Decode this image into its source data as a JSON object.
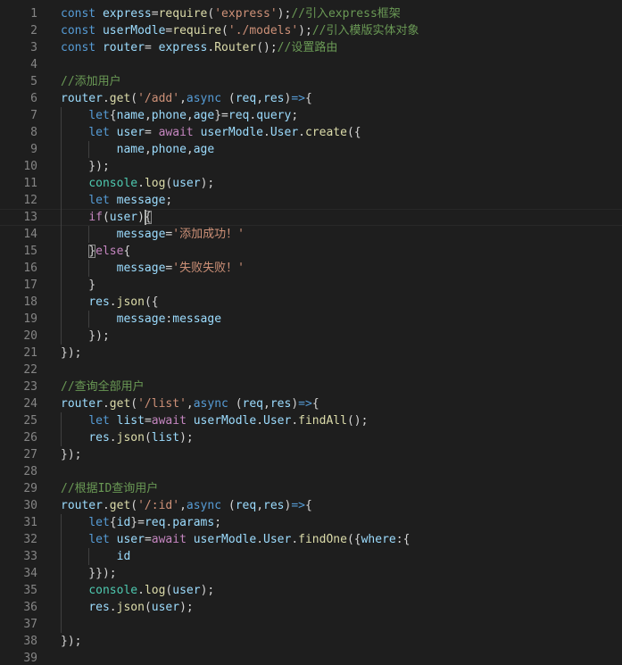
{
  "editor": {
    "language": "javascript",
    "active_line": 13,
    "lines": [
      {
        "no": "1",
        "tokens": [
          [
            "kw",
            "const "
          ],
          [
            "var",
            "express"
          ],
          [
            "txt",
            "="
          ],
          [
            "fn",
            "require"
          ],
          [
            "txt",
            "("
          ],
          [
            "str",
            "'express'"
          ],
          [
            "txt",
            ");"
          ],
          [
            "cmt",
            "//引入express框架"
          ]
        ]
      },
      {
        "no": "2",
        "tokens": [
          [
            "kw",
            "const "
          ],
          [
            "var",
            "userModle"
          ],
          [
            "txt",
            "="
          ],
          [
            "fn",
            "require"
          ],
          [
            "txt",
            "("
          ],
          [
            "str",
            "'./models'"
          ],
          [
            "txt",
            ");"
          ],
          [
            "cmt",
            "//引入模版实体对象"
          ]
        ]
      },
      {
        "no": "3",
        "tokens": [
          [
            "kw",
            "const "
          ],
          [
            "var",
            "router"
          ],
          [
            "txt",
            "= "
          ],
          [
            "var",
            "express"
          ],
          [
            "txt",
            "."
          ],
          [
            "fn",
            "Router"
          ],
          [
            "txt",
            "();"
          ],
          [
            "cmt",
            "//设置路由"
          ]
        ]
      },
      {
        "no": "4",
        "tokens": []
      },
      {
        "no": "5",
        "tokens": [
          [
            "cmt",
            "//添加用户"
          ]
        ]
      },
      {
        "no": "6",
        "tokens": [
          [
            "var",
            "router"
          ],
          [
            "txt",
            "."
          ],
          [
            "fn",
            "get"
          ],
          [
            "txt",
            "("
          ],
          [
            "str",
            "'/add'"
          ],
          [
            "txt",
            ","
          ],
          [
            "kw",
            "async "
          ],
          [
            "txt",
            "("
          ],
          [
            "var",
            "req"
          ],
          [
            "txt",
            ","
          ],
          [
            "var",
            "res"
          ],
          [
            "txt",
            ")"
          ],
          [
            "kw",
            "=>"
          ],
          [
            "txt",
            "{"
          ]
        ]
      },
      {
        "no": "7",
        "tokens": [
          [
            "txt",
            "    "
          ],
          [
            "kw",
            "let"
          ],
          [
            "txt",
            "{"
          ],
          [
            "var",
            "name"
          ],
          [
            "txt",
            ","
          ],
          [
            "var",
            "phone"
          ],
          [
            "txt",
            ","
          ],
          [
            "var",
            "age"
          ],
          [
            "txt",
            "}="
          ],
          [
            "var",
            "req"
          ],
          [
            "txt",
            "."
          ],
          [
            "var",
            "query"
          ],
          [
            "txt",
            ";"
          ]
        ]
      },
      {
        "no": "8",
        "tokens": [
          [
            "txt",
            "    "
          ],
          [
            "kw",
            "let "
          ],
          [
            "var",
            "user"
          ],
          [
            "txt",
            "= "
          ],
          [
            "ctl",
            "await "
          ],
          [
            "var",
            "userModle"
          ],
          [
            "txt",
            "."
          ],
          [
            "var",
            "User"
          ],
          [
            "txt",
            "."
          ],
          [
            "fn",
            "create"
          ],
          [
            "txt",
            "({"
          ]
        ]
      },
      {
        "no": "9",
        "tokens": [
          [
            "txt",
            "        "
          ],
          [
            "var",
            "name"
          ],
          [
            "txt",
            ","
          ],
          [
            "var",
            "phone"
          ],
          [
            "txt",
            ","
          ],
          [
            "var",
            "age"
          ]
        ]
      },
      {
        "no": "10",
        "tokens": [
          [
            "txt",
            "    });"
          ]
        ]
      },
      {
        "no": "11",
        "tokens": [
          [
            "txt",
            "    "
          ],
          [
            "cls",
            "console"
          ],
          [
            "txt",
            "."
          ],
          [
            "fn",
            "log"
          ],
          [
            "txt",
            "("
          ],
          [
            "var",
            "user"
          ],
          [
            "txt",
            ");"
          ]
        ]
      },
      {
        "no": "12",
        "tokens": [
          [
            "txt",
            "    "
          ],
          [
            "kw",
            "let "
          ],
          [
            "var",
            "message"
          ],
          [
            "txt",
            ";"
          ]
        ]
      },
      {
        "no": "13",
        "tokens": [
          [
            "txt",
            "    "
          ],
          [
            "ctl",
            "if"
          ],
          [
            "txt",
            "("
          ],
          [
            "var",
            "user"
          ],
          [
            "txt",
            ")"
          ],
          [
            "bm",
            "{"
          ]
        ]
      },
      {
        "no": "14",
        "tokens": [
          [
            "txt",
            "        "
          ],
          [
            "var",
            "message"
          ],
          [
            "txt",
            "="
          ],
          [
            "str",
            "'添加成功！'"
          ]
        ]
      },
      {
        "no": "15",
        "tokens": [
          [
            "txt",
            "    "
          ],
          [
            "bm",
            "}"
          ],
          [
            "ctl",
            "else"
          ],
          [
            "txt",
            "{"
          ]
        ]
      },
      {
        "no": "16",
        "tokens": [
          [
            "txt",
            "        "
          ],
          [
            "var",
            "message"
          ],
          [
            "txt",
            "="
          ],
          [
            "str",
            "'失败失败！'"
          ]
        ]
      },
      {
        "no": "17",
        "tokens": [
          [
            "txt",
            "    }"
          ]
        ]
      },
      {
        "no": "18",
        "tokens": [
          [
            "txt",
            "    "
          ],
          [
            "var",
            "res"
          ],
          [
            "txt",
            "."
          ],
          [
            "fn",
            "json"
          ],
          [
            "txt",
            "({"
          ]
        ]
      },
      {
        "no": "19",
        "tokens": [
          [
            "txt",
            "        "
          ],
          [
            "var",
            "message"
          ],
          [
            "txt",
            ":"
          ],
          [
            "var",
            "message"
          ]
        ]
      },
      {
        "no": "20",
        "tokens": [
          [
            "txt",
            "    });"
          ]
        ]
      },
      {
        "no": "21",
        "tokens": [
          [
            "txt",
            "});"
          ]
        ]
      },
      {
        "no": "22",
        "tokens": []
      },
      {
        "no": "23",
        "tokens": [
          [
            "cmt",
            "//查询全部用户"
          ]
        ]
      },
      {
        "no": "24",
        "tokens": [
          [
            "var",
            "router"
          ],
          [
            "txt",
            "."
          ],
          [
            "fn",
            "get"
          ],
          [
            "txt",
            "("
          ],
          [
            "str",
            "'/list'"
          ],
          [
            "txt",
            ","
          ],
          [
            "kw",
            "async "
          ],
          [
            "txt",
            "("
          ],
          [
            "var",
            "req"
          ],
          [
            "txt",
            ","
          ],
          [
            "var",
            "res"
          ],
          [
            "txt",
            ")"
          ],
          [
            "kw",
            "=>"
          ],
          [
            "txt",
            "{"
          ]
        ]
      },
      {
        "no": "25",
        "tokens": [
          [
            "txt",
            "    "
          ],
          [
            "kw",
            "let "
          ],
          [
            "var",
            "list"
          ],
          [
            "txt",
            "="
          ],
          [
            "ctl",
            "await "
          ],
          [
            "var",
            "userModle"
          ],
          [
            "txt",
            "."
          ],
          [
            "var",
            "User"
          ],
          [
            "txt",
            "."
          ],
          [
            "fn",
            "findAll"
          ],
          [
            "txt",
            "();"
          ]
        ]
      },
      {
        "no": "26",
        "tokens": [
          [
            "txt",
            "    "
          ],
          [
            "var",
            "res"
          ],
          [
            "txt",
            "."
          ],
          [
            "fn",
            "json"
          ],
          [
            "txt",
            "("
          ],
          [
            "var",
            "list"
          ],
          [
            "txt",
            ");"
          ]
        ]
      },
      {
        "no": "27",
        "tokens": [
          [
            "txt",
            "});"
          ]
        ]
      },
      {
        "no": "28",
        "tokens": []
      },
      {
        "no": "29",
        "tokens": [
          [
            "cmt",
            "//根据ID查询用户"
          ]
        ]
      },
      {
        "no": "30",
        "tokens": [
          [
            "var",
            "router"
          ],
          [
            "txt",
            "."
          ],
          [
            "fn",
            "get"
          ],
          [
            "txt",
            "("
          ],
          [
            "str",
            "'/:id'"
          ],
          [
            "txt",
            ","
          ],
          [
            "kw",
            "async "
          ],
          [
            "txt",
            "("
          ],
          [
            "var",
            "req"
          ],
          [
            "txt",
            ","
          ],
          [
            "var",
            "res"
          ],
          [
            "txt",
            ")"
          ],
          [
            "kw",
            "=>"
          ],
          [
            "txt",
            "{"
          ]
        ]
      },
      {
        "no": "31",
        "tokens": [
          [
            "txt",
            "    "
          ],
          [
            "kw",
            "let"
          ],
          [
            "txt",
            "{"
          ],
          [
            "var",
            "id"
          ],
          [
            "txt",
            "}="
          ],
          [
            "var",
            "req"
          ],
          [
            "txt",
            "."
          ],
          [
            "var",
            "params"
          ],
          [
            "txt",
            ";"
          ]
        ]
      },
      {
        "no": "32",
        "tokens": [
          [
            "txt",
            "    "
          ],
          [
            "kw",
            "let "
          ],
          [
            "var",
            "user"
          ],
          [
            "txt",
            "="
          ],
          [
            "ctl",
            "await "
          ],
          [
            "var",
            "userModle"
          ],
          [
            "txt",
            "."
          ],
          [
            "var",
            "User"
          ],
          [
            "txt",
            "."
          ],
          [
            "fn",
            "findOne"
          ],
          [
            "txt",
            "({"
          ],
          [
            "var",
            "where"
          ],
          [
            "txt",
            ":{"
          ]
        ]
      },
      {
        "no": "33",
        "tokens": [
          [
            "txt",
            "        "
          ],
          [
            "var",
            "id"
          ]
        ]
      },
      {
        "no": "34",
        "tokens": [
          [
            "txt",
            "    }});"
          ]
        ]
      },
      {
        "no": "35",
        "tokens": [
          [
            "txt",
            "    "
          ],
          [
            "cls",
            "console"
          ],
          [
            "txt",
            "."
          ],
          [
            "fn",
            "log"
          ],
          [
            "txt",
            "("
          ],
          [
            "var",
            "user"
          ],
          [
            "txt",
            ");"
          ]
        ]
      },
      {
        "no": "36",
        "tokens": [
          [
            "txt",
            "    "
          ],
          [
            "var",
            "res"
          ],
          [
            "txt",
            "."
          ],
          [
            "fn",
            "json"
          ],
          [
            "txt",
            "("
          ],
          [
            "var",
            "user"
          ],
          [
            "txt",
            ");"
          ]
        ]
      },
      {
        "no": "37",
        "tokens": []
      },
      {
        "no": "38",
        "tokens": [
          [
            "txt",
            "});"
          ]
        ]
      },
      {
        "no": "39",
        "tokens": []
      }
    ]
  },
  "colors": {
    "background": "#1e1e1e",
    "line_number": "#858585",
    "keyword": "#569cd6",
    "control": "#c586c0",
    "function": "#dcdcaa",
    "variable": "#9cdcfe",
    "class": "#4ec9b0",
    "string": "#ce9178",
    "comment": "#6a9955",
    "text": "#d4d4d4"
  }
}
